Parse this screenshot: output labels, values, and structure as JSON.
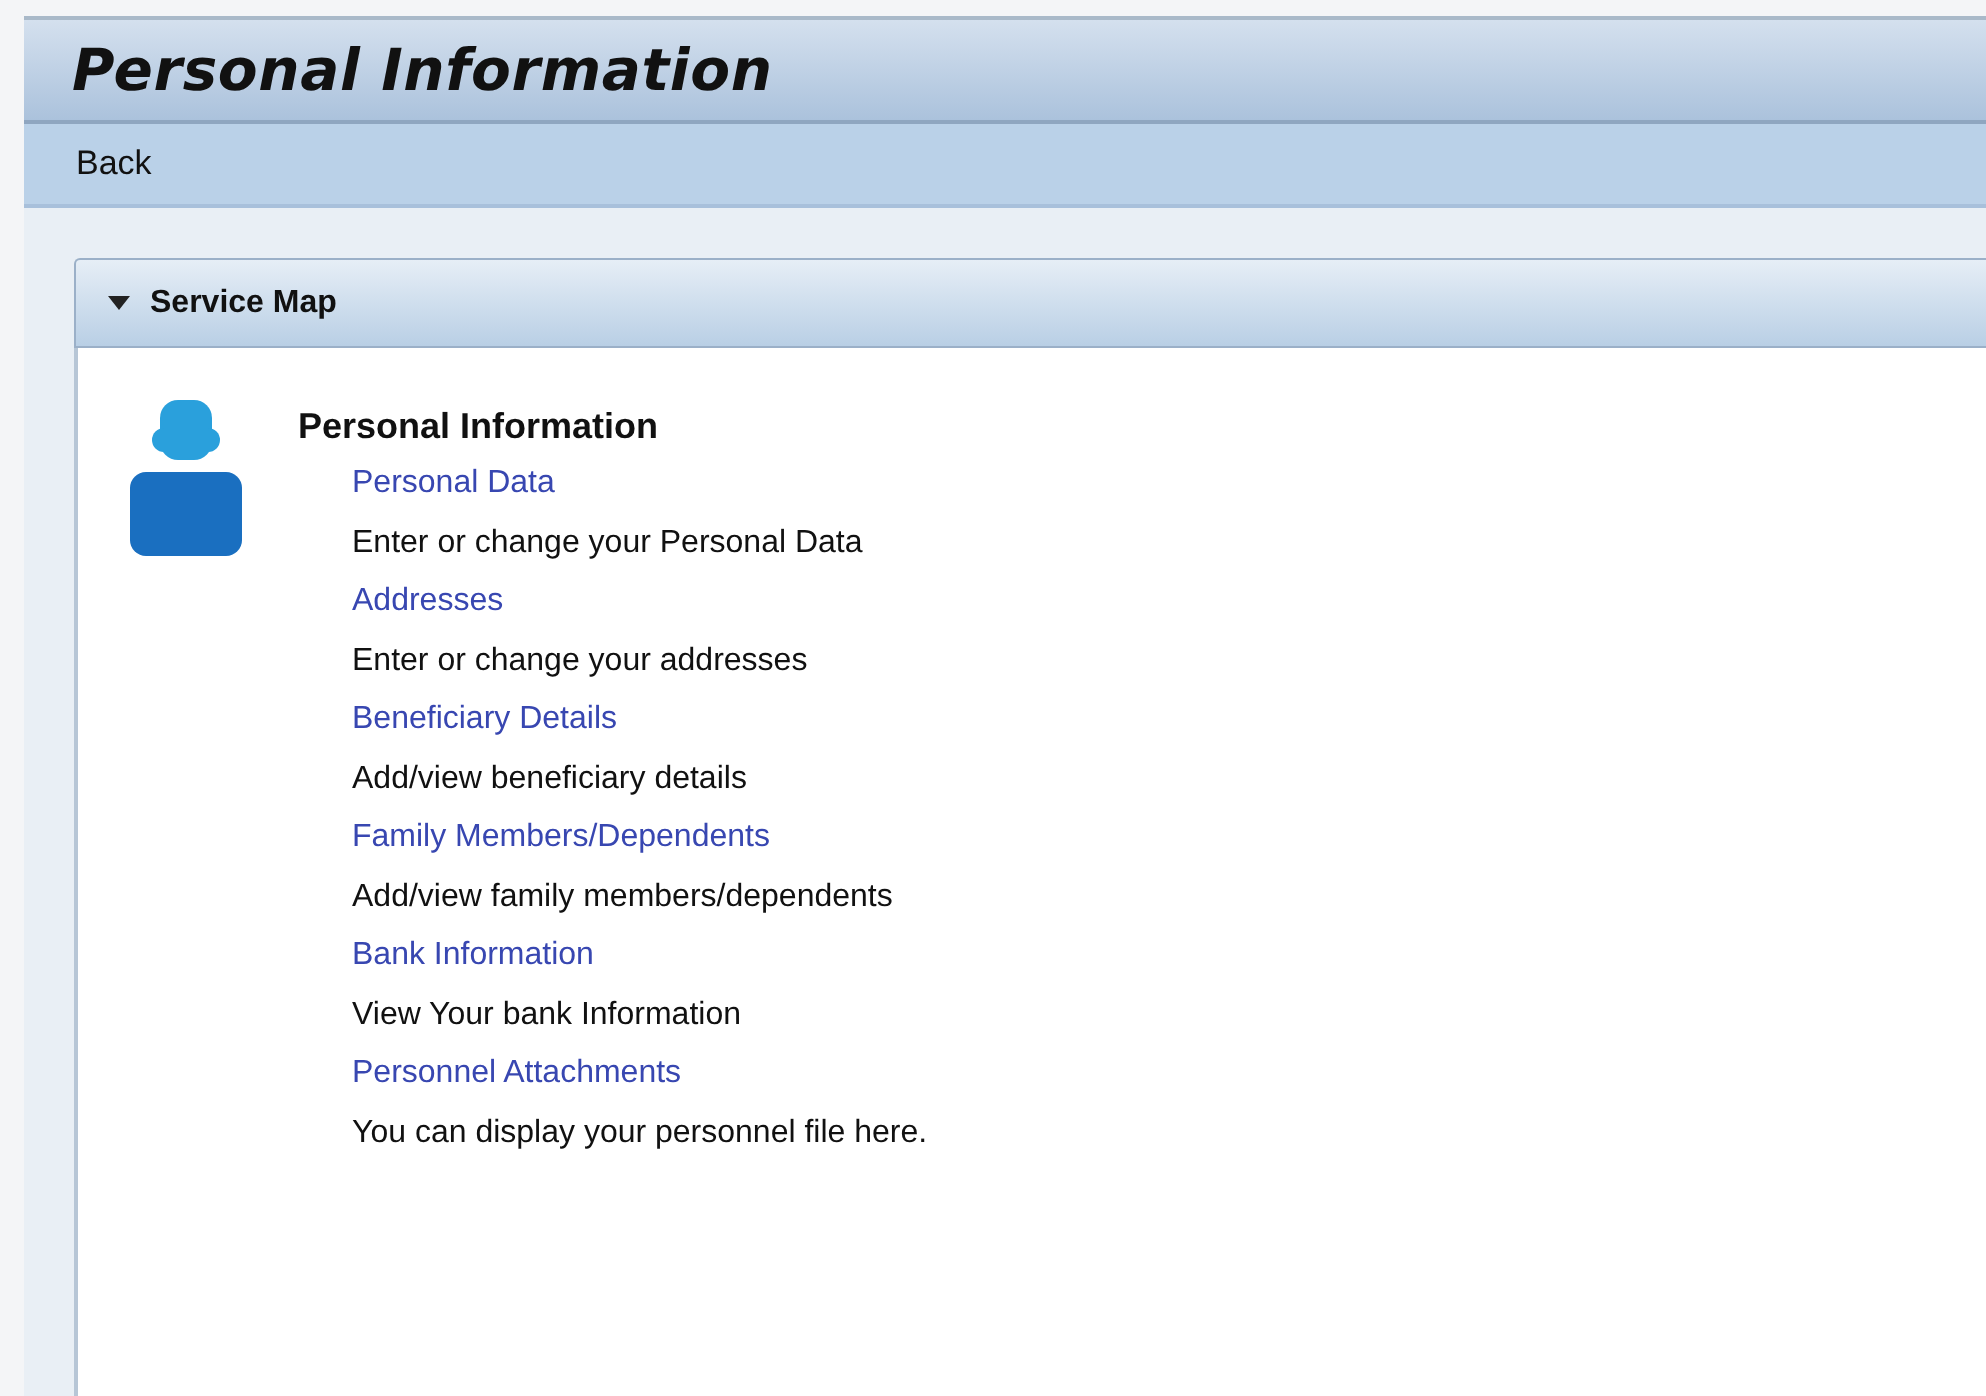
{
  "header": {
    "title": "Personal Information"
  },
  "toolbar": {
    "back": "Back"
  },
  "panel": {
    "title": "Service Map",
    "expanded": true,
    "section": {
      "title": "Personal Information",
      "services": [
        {
          "link": "Personal Data",
          "description": "Enter or change your Personal Data"
        },
        {
          "link": "Addresses",
          "description": "Enter or change your addresses"
        },
        {
          "link": "Beneficiary Details",
          "description": "Add/view beneficiary details"
        },
        {
          "link": "Family Members/Dependents",
          "description": "Add/view family members/dependents"
        },
        {
          "link": "Bank Information",
          "description": "View Your bank Information"
        },
        {
          "link": "Personnel Attachments",
          "description": "You can display your personnel file here."
        }
      ]
    }
  }
}
